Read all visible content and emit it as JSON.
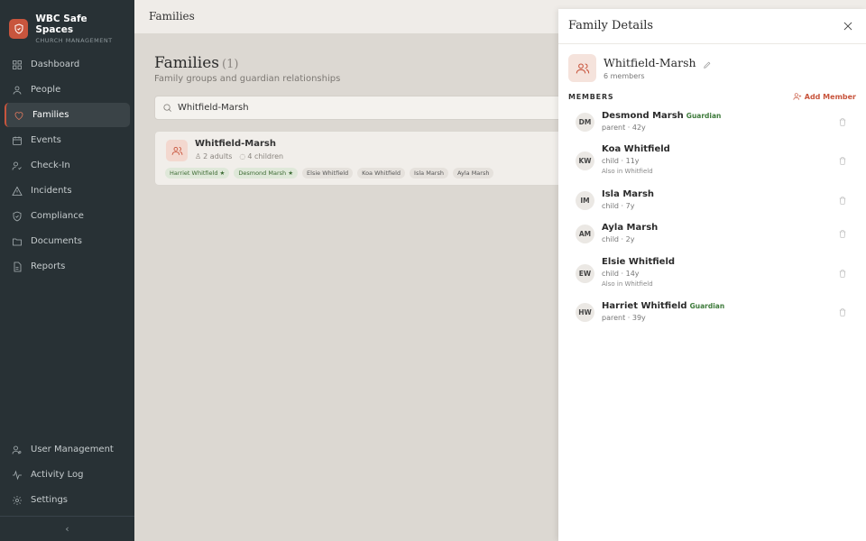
{
  "brand": {
    "name": "WBC Safe Spaces",
    "subtitle": "CHURCH MANAGEMENT"
  },
  "nav": [
    {
      "label": "Dashboard",
      "icon": "grid-icon"
    },
    {
      "label": "People",
      "icon": "person-icon"
    },
    {
      "label": "Families",
      "icon": "heart-icon",
      "active": true
    },
    {
      "label": "Events",
      "icon": "calendar-icon"
    },
    {
      "label": "Check-In",
      "icon": "checkin-icon"
    },
    {
      "label": "Incidents",
      "icon": "warning-icon"
    },
    {
      "label": "Compliance",
      "icon": "shield-icon"
    },
    {
      "label": "Documents",
      "icon": "folder-icon"
    },
    {
      "label": "Reports",
      "icon": "report-icon"
    }
  ],
  "nav_bottom": [
    {
      "label": "User Management",
      "icon": "users-icon"
    },
    {
      "label": "Activity Log",
      "icon": "activity-icon"
    },
    {
      "label": "Settings",
      "icon": "gear-icon"
    }
  ],
  "collapse_glyph": "‹",
  "topbar": {
    "title": "Families"
  },
  "page": {
    "title": "Families",
    "count": "(1)",
    "subtitle": "Family groups and guardian relationships",
    "search_value": "Whitfield-Marsh"
  },
  "family_card": {
    "name": "Whitfield-Marsh",
    "adults": "2 adults",
    "children": "4 children",
    "chips": [
      {
        "label": "Harriet Whitfield ★",
        "guardian": true
      },
      {
        "label": "Desmond Marsh ★",
        "guardian": true
      },
      {
        "label": "Elsie Whitfield",
        "guardian": false
      },
      {
        "label": "Koa Whitfield",
        "guardian": false
      },
      {
        "label": "Isla Marsh",
        "guardian": false
      },
      {
        "label": "Ayla Marsh",
        "guardian": false
      }
    ]
  },
  "drawer": {
    "title": "Family Details",
    "family_name": "Whitfield-Marsh",
    "member_count": "6 members",
    "members_label": "MEMBERS",
    "add_member": "Add Member",
    "members": [
      {
        "initials": "DM",
        "name": "Desmond Marsh",
        "badge": "Guardian",
        "sub": "parent · 42y",
        "also": ""
      },
      {
        "initials": "KW",
        "name": "Koa Whitfield",
        "badge": "",
        "sub": "child · 11y",
        "also": "Also in Whitfield"
      },
      {
        "initials": "IM",
        "name": "Isla Marsh",
        "badge": "",
        "sub": "child · 7y",
        "also": ""
      },
      {
        "initials": "AM",
        "name": "Ayla Marsh",
        "badge": "",
        "sub": "child · 2y",
        "also": ""
      },
      {
        "initials": "EW",
        "name": "Elsie Whitfield",
        "badge": "",
        "sub": "child · 14y",
        "also": "Also in Whitfield"
      },
      {
        "initials": "HW",
        "name": "Harriet Whitfield",
        "badge": "Guardian",
        "sub": "parent · 39y",
        "also": ""
      }
    ]
  },
  "colors": {
    "accent": "#c8553d",
    "sidebar": "#283135",
    "guardian": "#3d7a3a"
  }
}
